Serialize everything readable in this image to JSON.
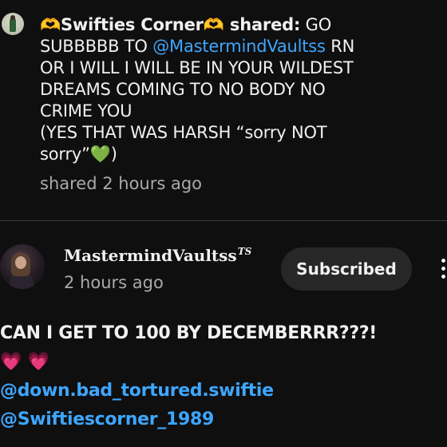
{
  "notification": {
    "sender": "🫶Swifties Corner🫶",
    "action": " shared:",
    "text_part1": " GO\nSUBBBBB TO ",
    "mention": "@MastermindVaultss",
    "text_part2": "  RN\nOR I WILL I WILL BE IN YOUR WILDEST\nDREAMS COMING TO NO BODY NO\nCRIME YOU\n(YES THAT WAS HARSH “sorry NOT\nsorry”💚)",
    "meta": "shared 2 hours ago"
  },
  "post": {
    "channel_name": "MastermindVaultss",
    "channel_badge": "TS",
    "time": "2 hours ago",
    "subscribe_label": "Subscribed",
    "line1": "CAN I GET TO 100 BY DECEMBERRR???!",
    "line2": "💗 💗",
    "mention1": "@down.bad_tortured.swiftie",
    "mention2": "@Swiftiescorner_1989"
  },
  "colors": {
    "background": "#0f0f0f",
    "text": "#f1f1f1",
    "secondary_text": "#aaaaaa",
    "link": "#3ea6ff",
    "button_bg": "#272727"
  },
  "icons": {
    "more": "more-vert-icon"
  }
}
